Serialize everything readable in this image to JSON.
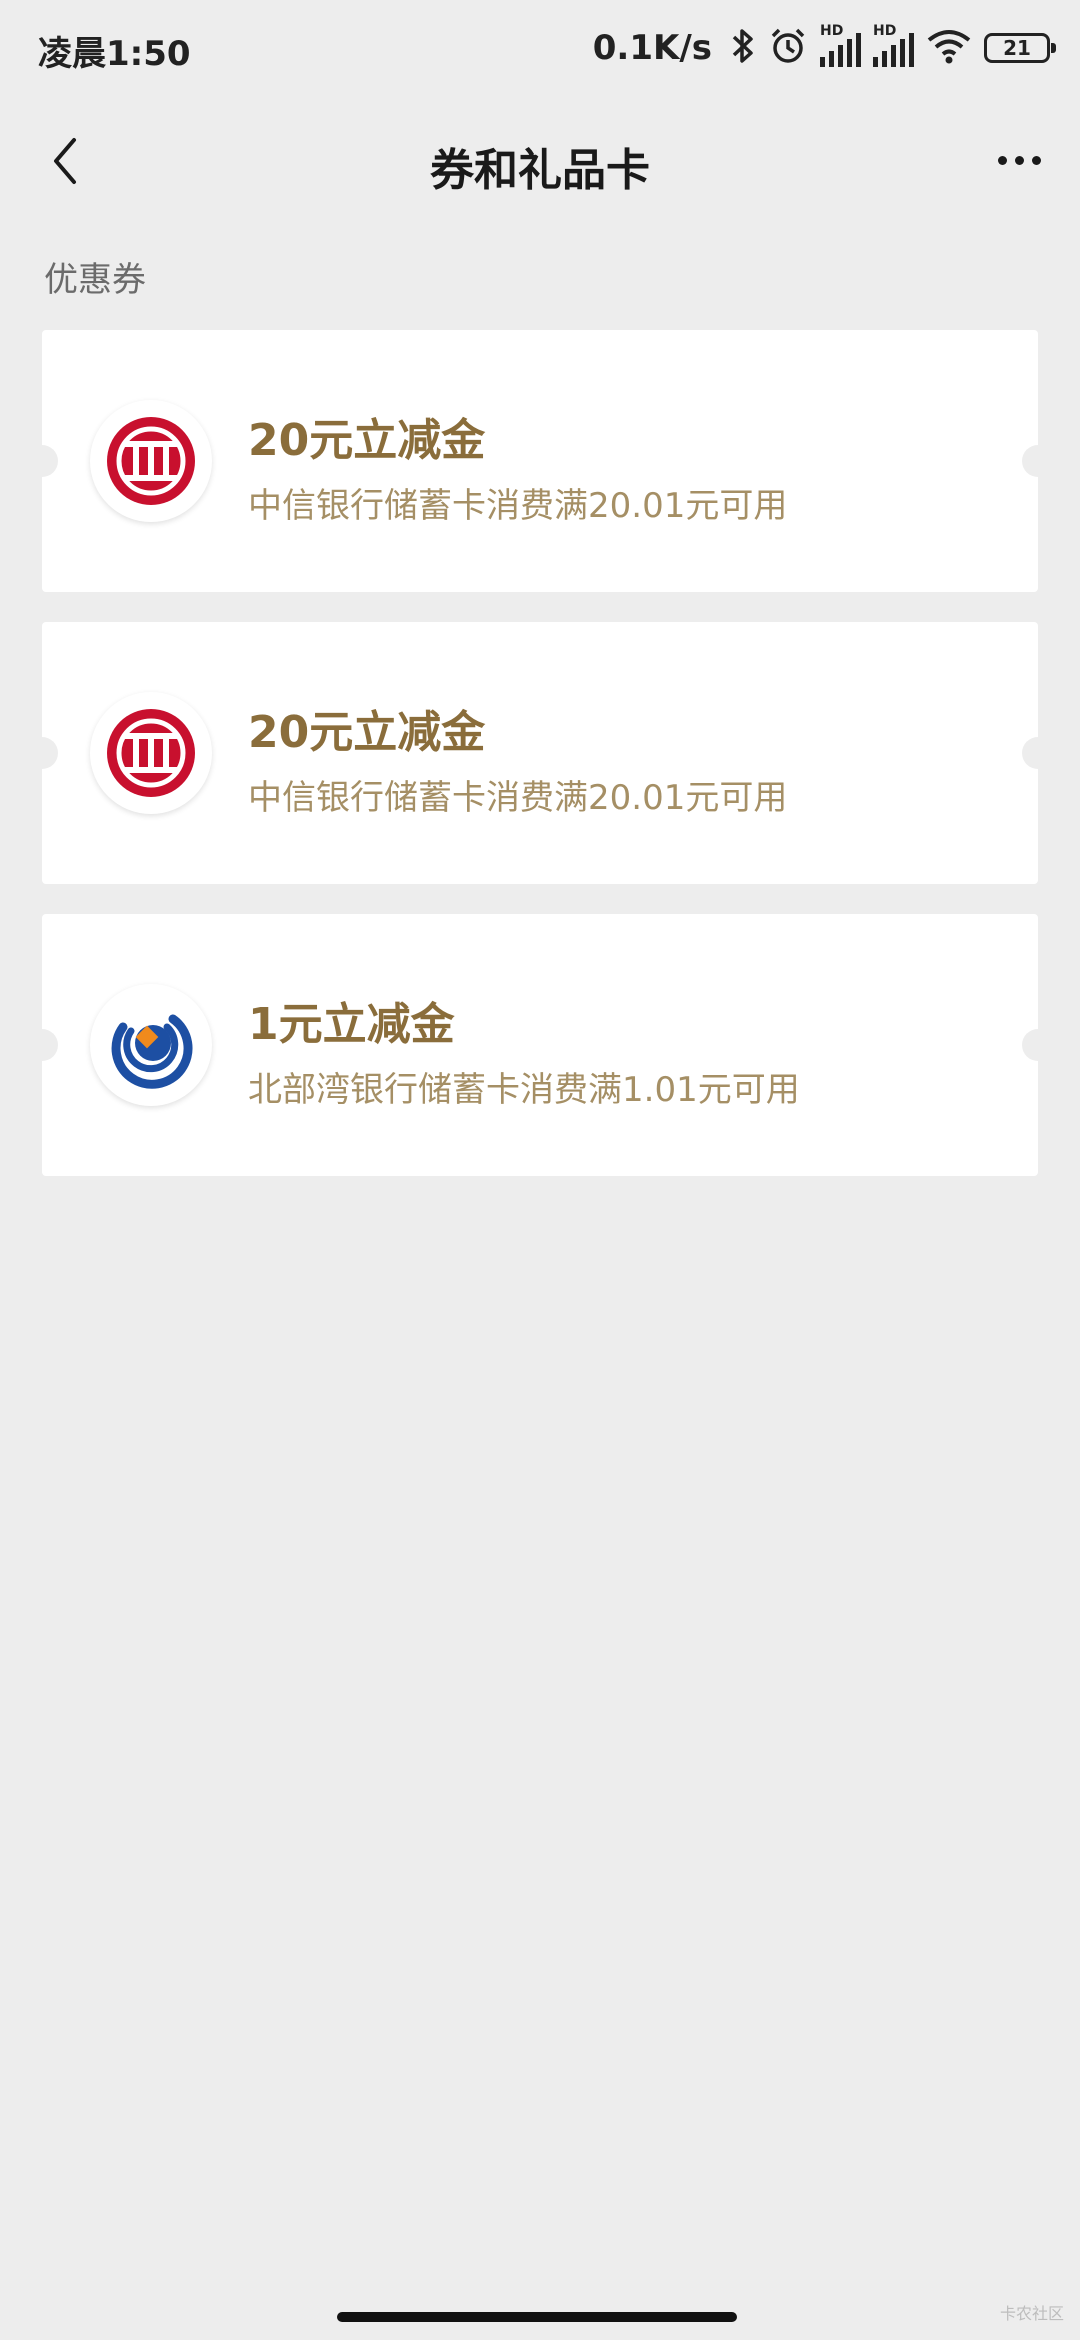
{
  "status_bar": {
    "time": "凌晨1:50",
    "net_speed": "0.1K/s",
    "battery": "21",
    "hd_label": "HD"
  },
  "nav": {
    "title": "券和礼品卡",
    "back_icon": "chevron-left-icon",
    "more_icon": "more-dots-icon"
  },
  "section_title": "优惠券",
  "coupons": [
    {
      "amount": "20元立减金",
      "description": "中信银行储蓄卡消费满20.01元可用",
      "logo": "citic-bank-logo",
      "logo_color": "#c8102e"
    },
    {
      "amount": "20元立减金",
      "description": "中信银行储蓄卡消费满20.01元可用",
      "logo": "citic-bank-logo",
      "logo_color": "#c8102e"
    },
    {
      "amount": "1元立减金",
      "description": "北部湾银行储蓄卡消费满1.01元可用",
      "logo": "beibuwan-bank-logo",
      "logo_color": "#1d4fa3"
    }
  ],
  "watermark": "卡农社区",
  "colors": {
    "background": "#ededed",
    "coupon_amount": "#8a6d3b",
    "coupon_desc": "#a58f65"
  }
}
